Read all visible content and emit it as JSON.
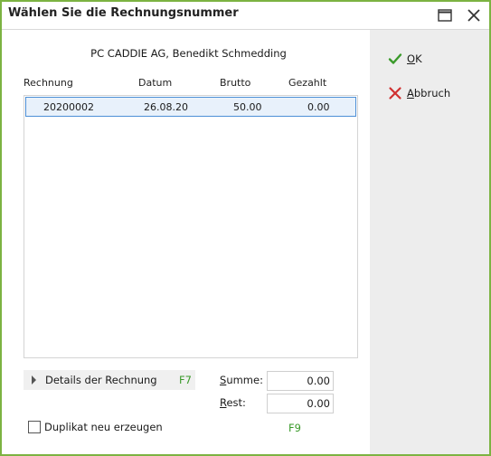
{
  "window": {
    "title": "Wählen Sie die Rechnungsnummer",
    "accent_color": "#7cb342"
  },
  "customer_name": "PC CADDIE AG, Benedikt Schmedding",
  "table": {
    "columns": [
      "Rechnung",
      "Datum",
      "Brutto",
      "Gezahlt"
    ],
    "rows": [
      {
        "rechnung": "20200002",
        "datum": "26.08.20",
        "brutto": "50.00",
        "gezahlt": "0.00",
        "selected": true
      }
    ]
  },
  "details": {
    "label": "Details der Rechnung",
    "key": "F7"
  },
  "summe": {
    "label_accel": "S",
    "label_rest": "umme:",
    "value": "0.00"
  },
  "rest": {
    "label_accel": "R",
    "label_rest": "est:",
    "value": "0.00"
  },
  "duplicate": {
    "label": "Duplikat neu erzeugen",
    "checked": false,
    "key": "F9"
  },
  "buttons": {
    "ok": {
      "accel": "O",
      "rest": "K",
      "icon": "check-icon",
      "color": "#3a9a2a"
    },
    "cancel": {
      "accel": "A",
      "rest": "bbruch",
      "icon": "close-icon",
      "color": "#d03030"
    }
  }
}
